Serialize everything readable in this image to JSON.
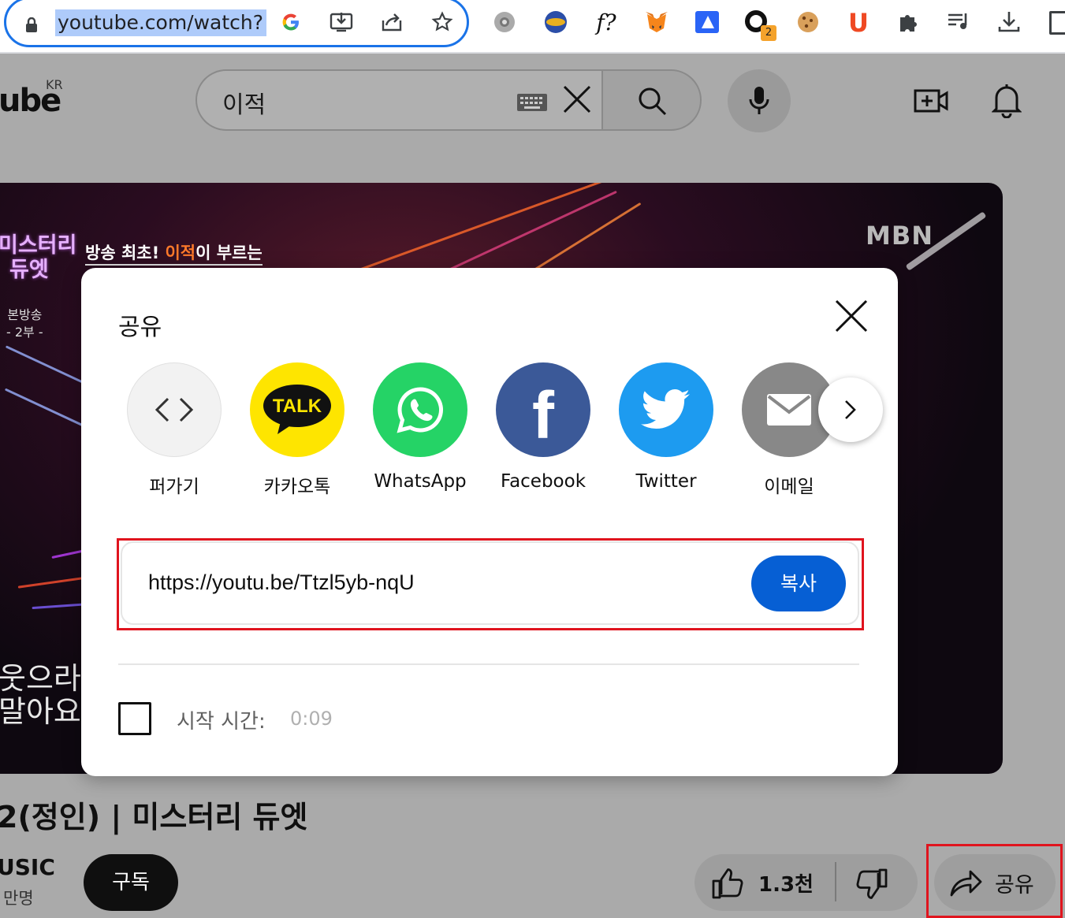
{
  "browser": {
    "url": "youtube.com/watch?",
    "extension_badge": "2"
  },
  "youtube": {
    "logo_text": "ube",
    "logo_region": "KR",
    "search_query": "이적"
  },
  "video": {
    "channel_watermark": "MBN",
    "show_logo_line1": "미스터리",
    "show_logo_line2": "듀엣",
    "caption_prefix": "방송 최초! ",
    "caption_highlight": "이적",
    "caption_suffix": "이 부르는",
    "broadcast_label": "본방송",
    "broadcast_part": "- 2부 -",
    "lyrics_line1": "웃으라",
    "lyrics_line2": "말아요"
  },
  "watch": {
    "title": "2(정인) | 미스터리 듀엣",
    "channel_name": "USIC",
    "subscriber_count": "만명",
    "subscribe_label": "구독",
    "like_count": "1.3천",
    "share_label": "공유"
  },
  "share_dialog": {
    "title": "공유",
    "targets": [
      {
        "label": "퍼가기",
        "icon": "embed-icon",
        "color": "#f2f2f2"
      },
      {
        "label": "카카오톡",
        "icon": "kakaotalk-icon",
        "color": "#fee500",
        "icon_text": "TALK"
      },
      {
        "label": "WhatsApp",
        "icon": "whatsapp-icon",
        "color": "#25d366"
      },
      {
        "label": "Facebook",
        "icon": "facebook-icon",
        "color": "#3b5998",
        "icon_text": "f"
      },
      {
        "label": "Twitter",
        "icon": "twitter-icon",
        "color": "#1d9bf0"
      },
      {
        "label": "이메일",
        "icon": "email-icon",
        "color": "#888888"
      }
    ],
    "link": "https://youtu.be/Ttzl5yb-nqU",
    "copy_label": "복사",
    "start_time_label": "시작 시간:",
    "start_time_value": "0:09"
  }
}
